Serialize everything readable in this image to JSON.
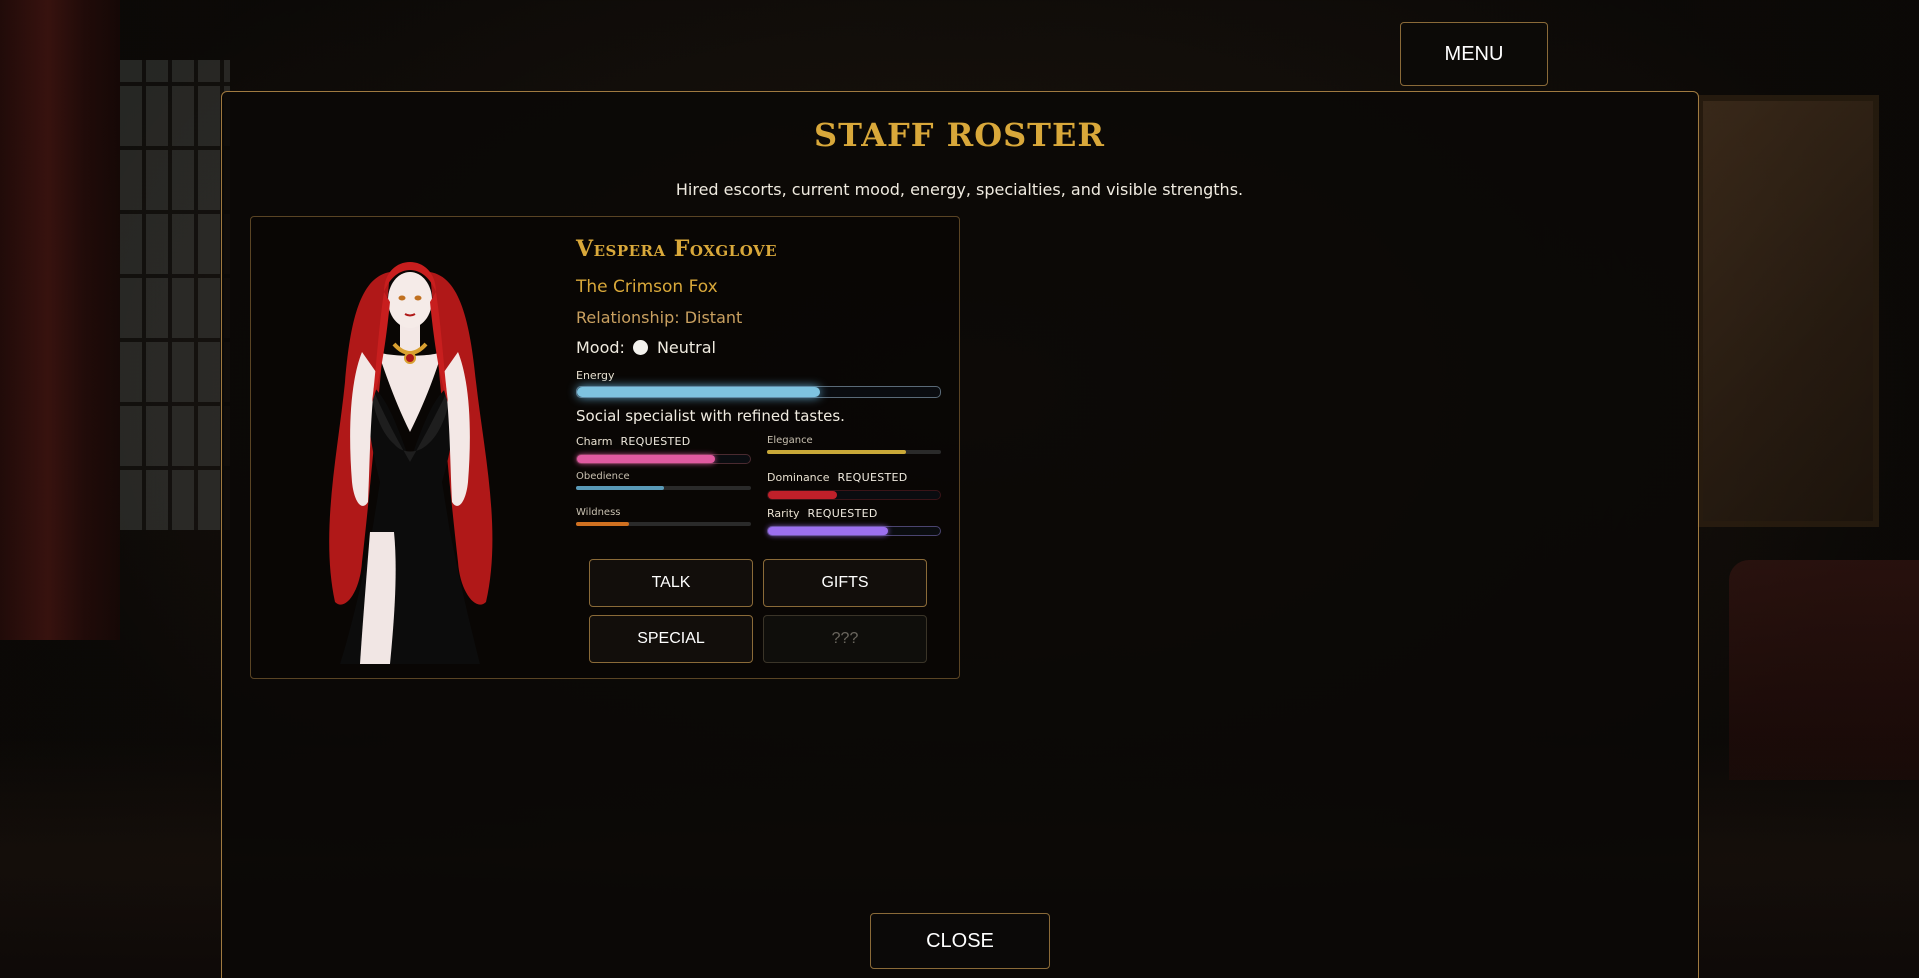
{
  "menu": {
    "label": "MENU"
  },
  "roster": {
    "title": "STAFF ROSTER",
    "subtitle": "Hired escorts, current mood, energy, specialties, and visible strengths."
  },
  "staff": [
    {
      "name": "Vespera Foxglove",
      "title": "The Crimson Fox",
      "relationship": "Relationship: Distant",
      "mood_label": "Mood:",
      "mood_value": "Neutral",
      "energy_label": "Energy",
      "energy_pct": 67,
      "specialty": "Social specialist with refined tastes.",
      "stats": {
        "charm": {
          "label": "Charm",
          "tag": "REQUESTED",
          "pct": 80,
          "color": "#e05aa0"
        },
        "elegance": {
          "label": "Elegance",
          "tag": "",
          "pct": 80,
          "color": "#c9a838"
        },
        "obedience": {
          "label": "Obedience",
          "tag": "",
          "pct": 50,
          "color": "#5a9ab8"
        },
        "dominance": {
          "label": "Dominance",
          "tag": "REQUESTED",
          "pct": 40,
          "color": "#c0202a"
        },
        "wildness": {
          "label": "Wildness",
          "tag": "",
          "pct": 30,
          "color": "#d07020"
        },
        "rarity": {
          "label": "Rarity",
          "tag": "REQUESTED",
          "pct": 70,
          "color": "#9c70f0"
        }
      },
      "actions": {
        "talk": "TALK",
        "gifts": "GIFTS",
        "special": "SPECIAL",
        "locked": "???"
      }
    }
  ],
  "close": {
    "label": "CLOSE"
  },
  "colors": {
    "accent": "#d9a83a",
    "energy": "#7ec3e0",
    "border": "#8a6a38"
  }
}
